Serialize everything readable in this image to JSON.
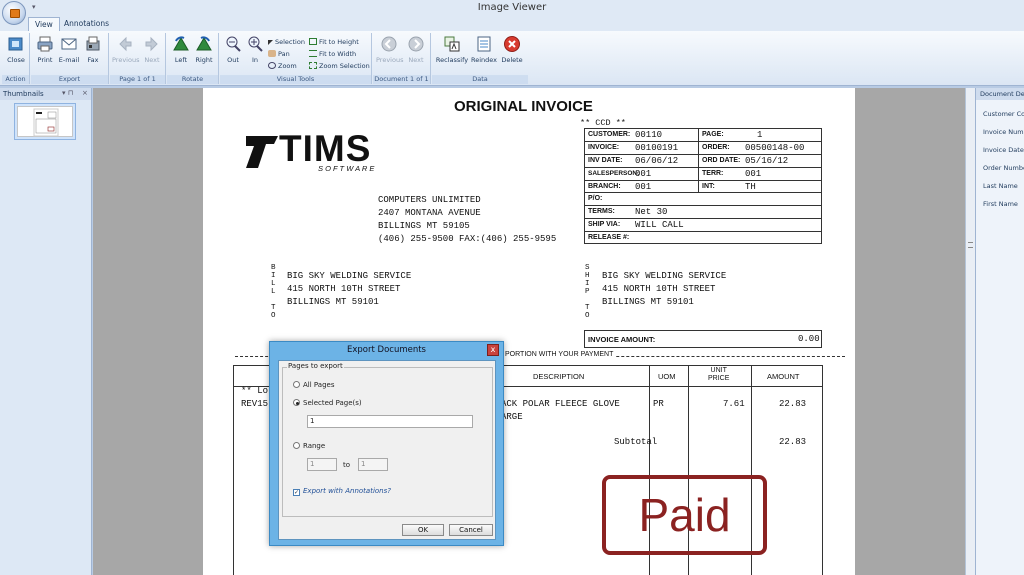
{
  "window": {
    "title": "Image Viewer"
  },
  "tabs": [
    "View",
    "Annotations"
  ],
  "ribbon": {
    "groups": [
      "Action",
      "Export",
      "Page 1 of 1",
      "Rotate",
      "Visual Tools",
      "Document 1 of 1",
      "Data"
    ],
    "close": "Close",
    "print": "Print",
    "email": "E-mail",
    "fax": "Fax",
    "previous": "Previous",
    "next": "Next",
    "left": "Left",
    "right": "Right",
    "out": "Out",
    "in": "In",
    "selection": "Selection",
    "pan": "Pan",
    "zoom": "Zoom",
    "fit_height": "Fit to Height",
    "fit_width": "Fit to Width",
    "zoom_selection": "Zoom Selection",
    "doc_previous": "Previous",
    "doc_next": "Next",
    "reclassify": "Reclassify",
    "reindex": "Reindex",
    "delete": "Delete"
  },
  "thumbnails": {
    "title": "Thumbnails",
    "pin": "▾ ⊓",
    "close": "×"
  },
  "doc_panel": {
    "title": "Document Det",
    "fields": [
      "Customer Co",
      "Invoice Numb",
      "Invoice Date",
      "Order Numbe",
      "Last Name",
      "First Name"
    ]
  },
  "invoice": {
    "heading": "ORIGINAL INVOICE",
    "ccd": "** CCD **",
    "logo_main": "TIMS",
    "logo_sub": "S O F T W A R E",
    "company": [
      "COMPUTERS UNLIMITED",
      "2407 MONTANA AVENUE",
      "BILLINGS MT 59105",
      "(406) 255-9500 FAX:(406) 255-9595"
    ],
    "header_rows": [
      [
        "CUSTOMER:",
        "00110",
        "PAGE:",
        "1"
      ],
      [
        "INVOICE:",
        "00100191",
        "ORDER:",
        "00500148-00"
      ],
      [
        "INV DATE:",
        "06/06/12",
        "ORD DATE:",
        "05/16/12"
      ],
      [
        "SALESPERSON:",
        "001",
        "TERR:",
        "001"
      ],
      [
        "BRANCH:",
        "001",
        "INT:",
        "TH"
      ]
    ],
    "po_label": "P/O:",
    "terms_label": "TERMS:",
    "terms": "Net 30",
    "shipvia_label": "SHIP VIA:",
    "shipvia": "WILL CALL",
    "release_label": "RELEASE #:",
    "bill_to_letters": "B\nI\nL\nL\n\nT\nO",
    "ship_to_letters": "S\nH\nI\nP\n\nT\nO",
    "bill_to": [
      "BIG SKY WELDING SERVICE",
      "415 NORTH 10TH STREET",
      "BILLINGS MT 59101"
    ],
    "ship_to": [
      "BIG SKY WELDING SERVICE",
      "415 NORTH 10TH STREET",
      "BILLINGS MT 59101"
    ],
    "invoice_amount_label": "INVOICE AMOUNT:",
    "invoice_amount": "0.00",
    "tear_text": "PORTION WITH YOUR PAYMENT",
    "columns": [
      "DESCRIPTION",
      "UOM",
      "UNIT\nPRICE",
      "AMOUNT"
    ],
    "left_frag_1": "** Lo",
    "left_frag_2": "REV15",
    "line_desc_1": "ACK POLAR FLEECE GLOVE",
    "line_desc_2": "ARGE",
    "line_uom": "PR",
    "line_price": "7.61",
    "line_amount": "22.83",
    "subtotal_label": "Subtotal",
    "subtotal": "22.83",
    "stamp": "Paid"
  },
  "dialog": {
    "title": "Export Documents",
    "close": "x",
    "group_label": "Pages to export",
    "all_pages": "All Pages",
    "selected_pages": "Selected Page(s)",
    "selected_value": "1",
    "range": "Range",
    "range_from": "1",
    "to": "to",
    "range_to": "1",
    "export_annotations": "Export with Annotations?",
    "ok": "OK",
    "cancel": "Cancel"
  }
}
